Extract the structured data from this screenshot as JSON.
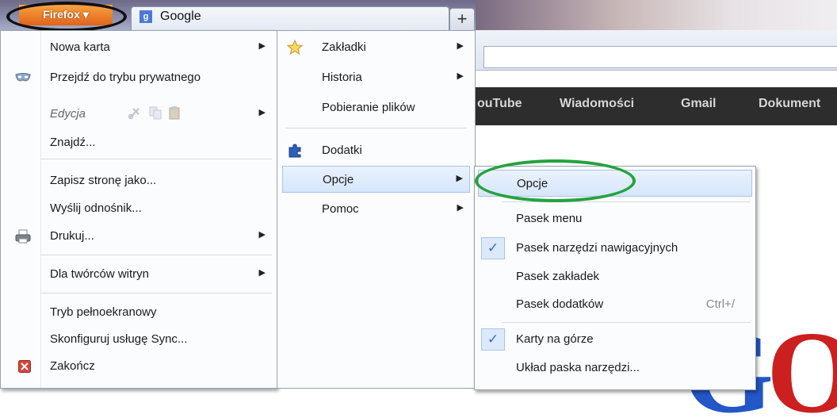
{
  "browser": {
    "firefox_button": "Firefox ▾",
    "tab_title": "Google",
    "new_tab_symbol": "+"
  },
  "google_bar": [
    "ouTube",
    "Wiadomości",
    "Gmail",
    "Dokument"
  ],
  "logo_letters": [
    "G",
    "O"
  ],
  "main_menu": {
    "items": [
      {
        "label": "Nowa karta"
      },
      {
        "label": "Przejdź do trybu prywatnego"
      },
      {
        "label": "Edycja"
      },
      {
        "label": "Znajdź..."
      },
      {
        "label": "Zapisz stronę jako..."
      },
      {
        "label": "Wyślij odnośnik..."
      },
      {
        "label": "Drukuj..."
      },
      {
        "label": "Dla twórców witryn"
      },
      {
        "label": "Tryb pełnoekranowy"
      },
      {
        "label": "Skonfiguruj usługę Sync..."
      },
      {
        "label": "Zakończ"
      }
    ]
  },
  "right_menu": {
    "items": [
      {
        "label": "Zakładki"
      },
      {
        "label": "Historia"
      },
      {
        "label": "Pobieranie plików"
      },
      {
        "label": "Dodatki"
      },
      {
        "label": "Opcje"
      },
      {
        "label": "Pomoc"
      }
    ]
  },
  "options_submenu": {
    "items": [
      {
        "label": "Opcje"
      },
      {
        "label": "Pasek menu"
      },
      {
        "label": "Pasek narzędzi nawigacyjnych"
      },
      {
        "label": "Pasek zakładek"
      },
      {
        "label": "Pasek dodatków",
        "shortcut": "Ctrl+/"
      },
      {
        "label": "Karty na górze"
      },
      {
        "label": "Układ paska narzędzi..."
      }
    ]
  },
  "colors": {
    "firefox_orange": "#e0631a",
    "highlight": "#d6e6fb",
    "annotation_green": "#25a23e",
    "annotation_black": "#111111"
  }
}
